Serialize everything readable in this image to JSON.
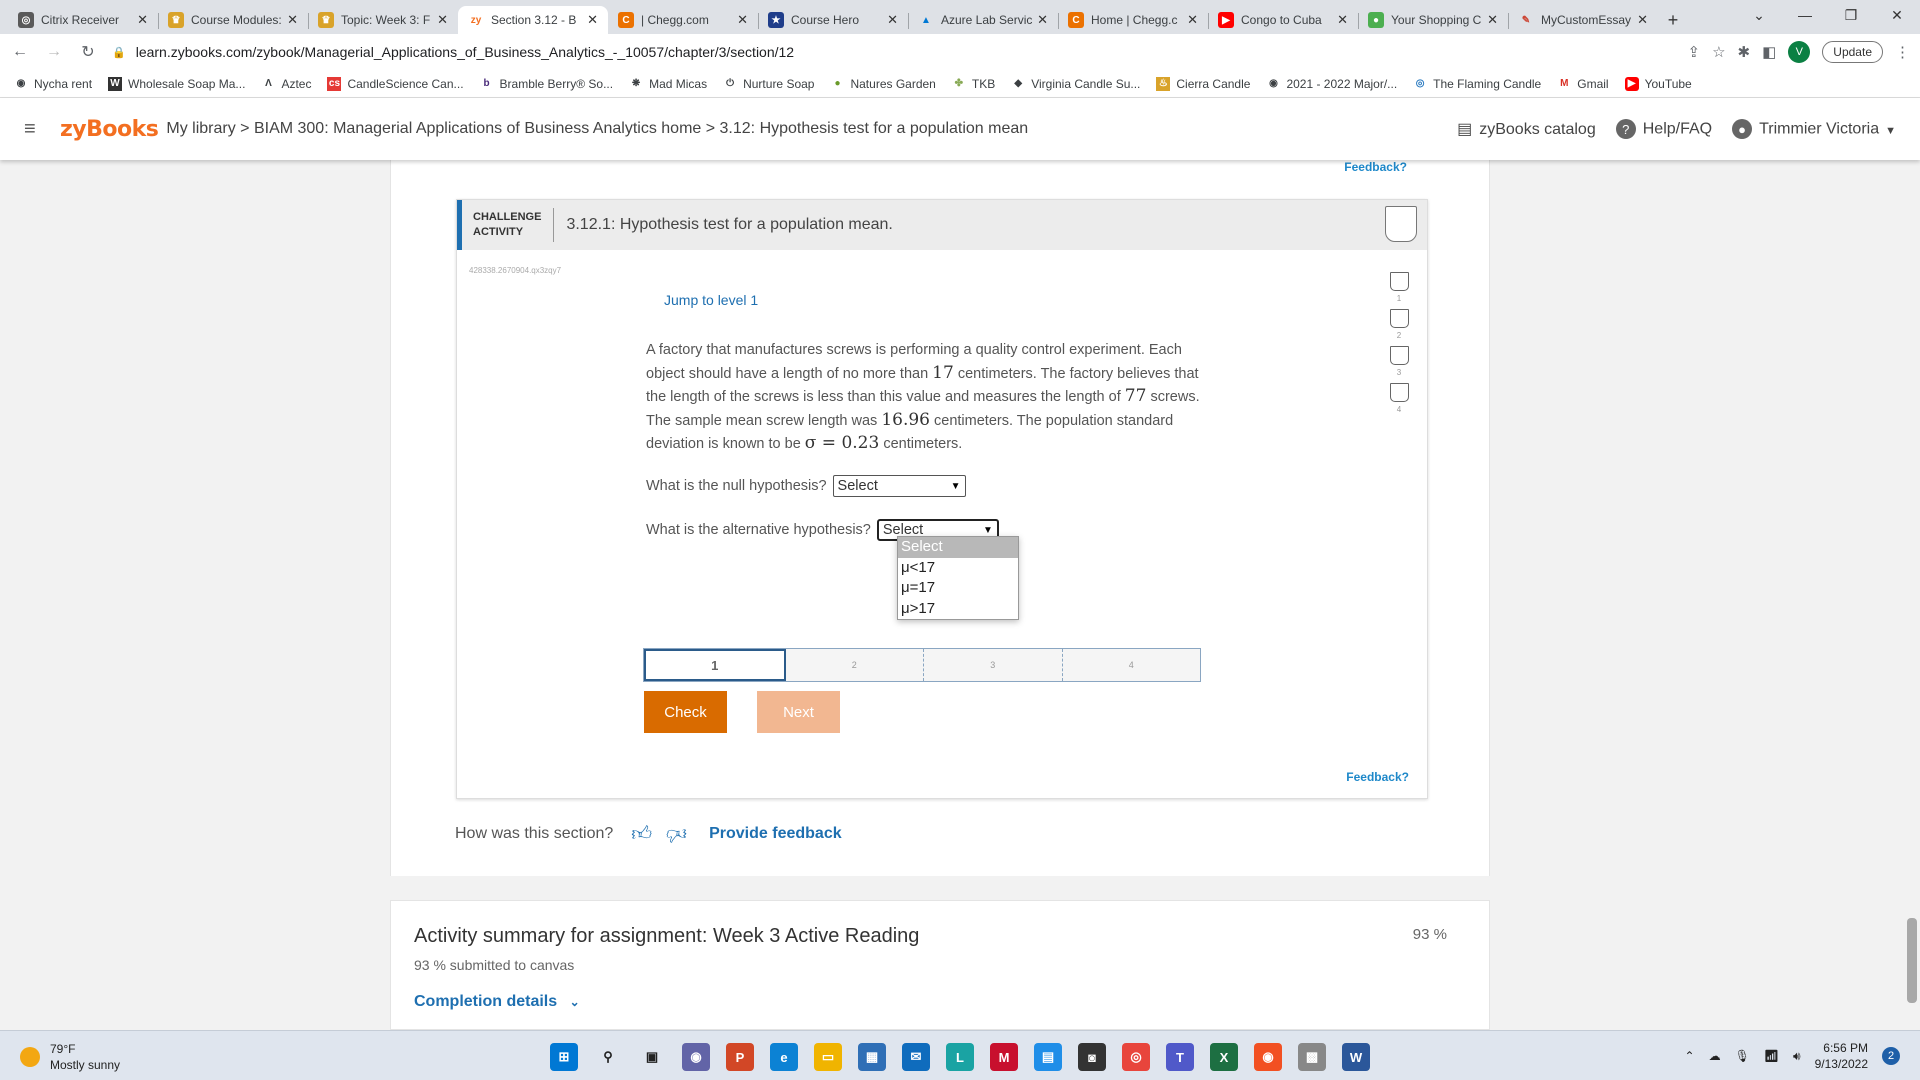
{
  "browser": {
    "tabs": [
      {
        "title": "Citrix Receiver",
        "icon": "citrix-icon",
        "color": "#5a5a5a"
      },
      {
        "title": "Course Modules:",
        "icon": "canvas-icon",
        "color": "#d9a32a"
      },
      {
        "title": "Topic: Week 3: F",
        "icon": "canvas-icon",
        "color": "#d9a32a"
      },
      {
        "title": "Section 3.12 - B",
        "icon": "zybooks-icon",
        "color": "#f36f21",
        "active": true
      },
      {
        "title": "| Chegg.com",
        "icon": "chegg-icon",
        "color": "#eb7100"
      },
      {
        "title": "Course Hero",
        "icon": "coursehero-icon",
        "color": "#1f3d8a"
      },
      {
        "title": "Azure Lab Servic",
        "icon": "azure-icon",
        "color": "#0078d4"
      },
      {
        "title": "Home | Chegg.c",
        "icon": "chegg-icon",
        "color": "#eb7100"
      },
      {
        "title": "Congo to Cuba",
        "icon": "youtube-icon",
        "color": "#ff0000"
      },
      {
        "title": "Your Shopping C",
        "icon": "shopping-icon",
        "color": "#4caf50"
      },
      {
        "title": "MyCustomEssay",
        "icon": "pen-icon",
        "color": "#c43"
      }
    ],
    "url": "learn.zybooks.com/zybook/Managerial_Applications_of_Business_Analytics_-_10057/chapter/3/section/12",
    "avatar_letter": "V",
    "update_label": "Update",
    "bookmarks": [
      {
        "label": "Nycha rent",
        "icon": "globe-icon"
      },
      {
        "label": "Wholesale Soap Ma...",
        "icon": "w-icon"
      },
      {
        "label": "Aztec",
        "icon": "aztec-icon"
      },
      {
        "label": "CandleScience Can...",
        "icon": "cs-icon"
      },
      {
        "label": "Bramble Berry® So...",
        "icon": "b-icon"
      },
      {
        "label": "Mad Micas",
        "icon": "micas-icon"
      },
      {
        "label": "Nurture Soap",
        "icon": "power-icon"
      },
      {
        "label": "Natures Garden",
        "icon": "leaf-icon"
      },
      {
        "label": "TKB",
        "icon": "tkb-icon"
      },
      {
        "label": "Virginia Candle Su...",
        "icon": "diamond-icon"
      },
      {
        "label": "Cierra Candle",
        "icon": "flame-icon"
      },
      {
        "label": "2021 - 2022 Major/...",
        "icon": "globe-icon"
      },
      {
        "label": "The Flaming Candle",
        "icon": "candle-icon"
      },
      {
        "label": "Gmail",
        "icon": "gmail-icon"
      },
      {
        "label": "YouTube",
        "icon": "youtube-icon"
      }
    ]
  },
  "header": {
    "logo": "zyBooks",
    "breadcrumb": "My library > BIAM 300: Managerial Applications of Business Analytics home > 3.12: Hypothesis test for a population mean",
    "catalog": "zyBooks catalog",
    "help": "Help/FAQ",
    "user": "Trimmier Victoria"
  },
  "activity": {
    "feedback_top": "Feedback?",
    "label_line1": "CHALLENGE",
    "label_line2": "ACTIVITY",
    "title": "3.12.1: Hypothesis test for a population mean.",
    "id": "428338.2670904.qx3zqy7",
    "jump": "Jump to level 1",
    "problem": {
      "t1": "A factory that manufactures screws is performing a quality control experiment. Each object should have a length of no more than ",
      "v1": "17",
      "t2": " centimeters. The factory believes that the length of the screws is less than this value and measures the length of ",
      "v2": "77",
      "t3": " screws. The sample mean screw length was ",
      "v3": "16.96",
      "t4": " centimeters. The population standard deviation is known to be ",
      "v4": "σ = 0.23",
      "t5": " centimeters."
    },
    "q_null": "What is the null hypothesis?",
    "q_alt": "What is the alternative hypothesis?",
    "select_value": "Select",
    "options": [
      "Select",
      "μ<17",
      "μ=17",
      "μ>17"
    ],
    "levels": [
      "1",
      "2",
      "3",
      "4"
    ],
    "check": "Check",
    "next": "Next",
    "feedback_bottom": "Feedback?"
  },
  "rating": {
    "question": "How was this section?",
    "provide": "Provide feedback"
  },
  "summary": {
    "title": "Activity summary for assignment: Week 3 Active Reading",
    "percent": "93 %",
    "submitted": "93 % submitted to canvas",
    "details": "Completion details"
  },
  "taskbar": {
    "temp": "79°F",
    "weather": "Mostly sunny",
    "time": "6:56 PM",
    "date": "9/13/2022",
    "notifications": "2"
  },
  "colors": {
    "accent": "#f36f21",
    "link": "#1e6fb0",
    "check": "#d96b00",
    "next": "#f2b791"
  }
}
